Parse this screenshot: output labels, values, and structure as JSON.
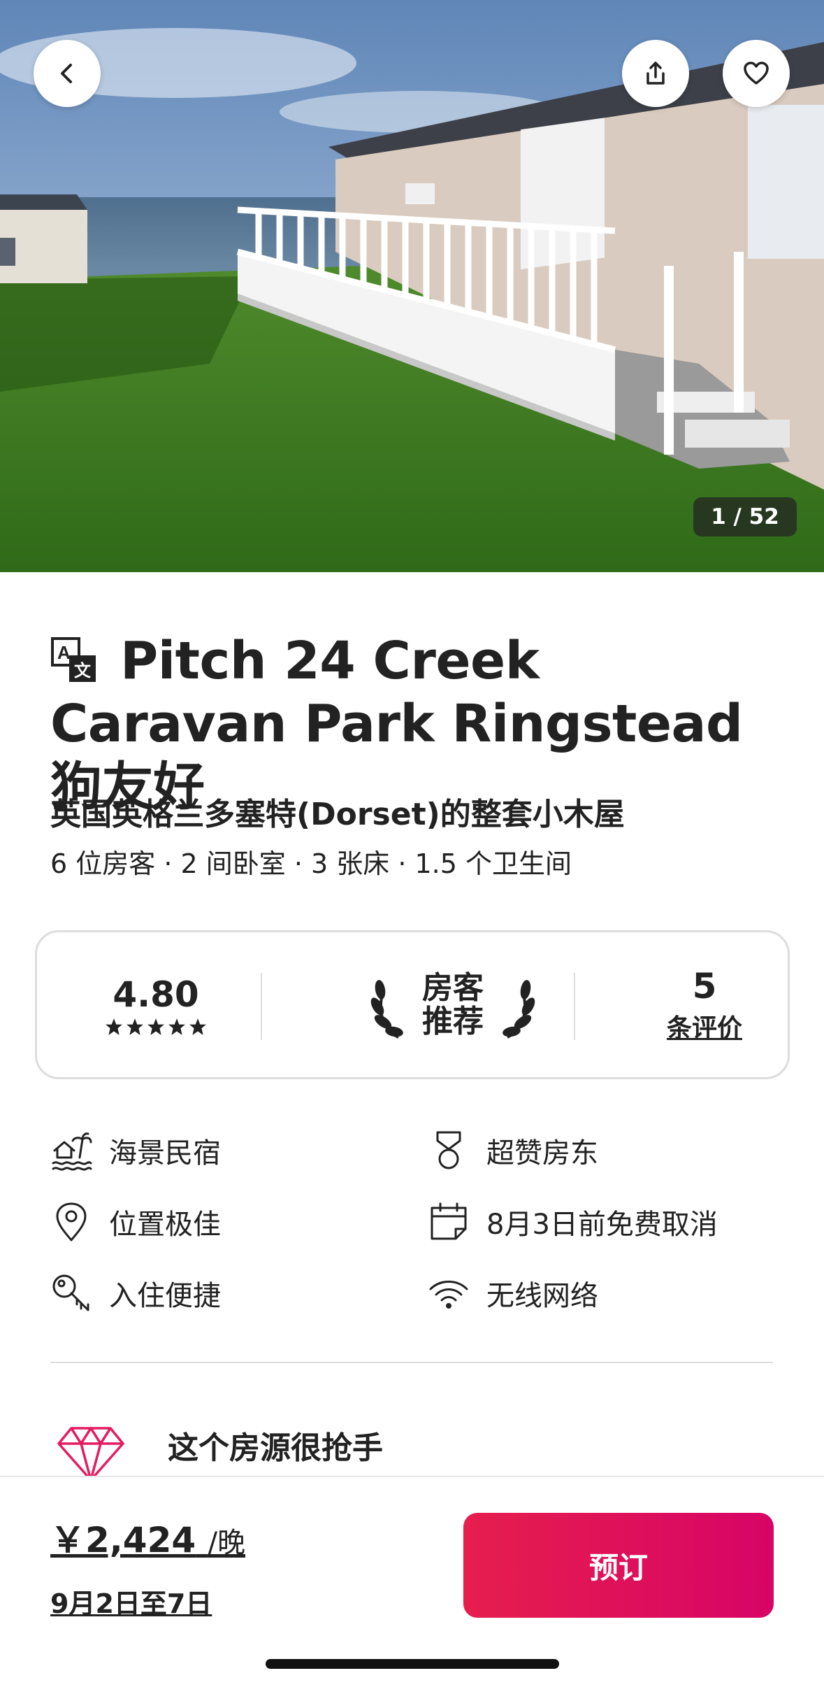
{
  "hero": {
    "photo_counter": "1 / 52"
  },
  "listing": {
    "title": "Pitch 24 Creek Caravan Park Ringstead狗友好",
    "subtitle": "英国英格兰多塞特(Dorset)的整套小木屋",
    "facts": "6 位房客 · 2 间卧室 · 3 张床 · 1.5 个卫生间"
  },
  "rating": {
    "score": "4.80",
    "stars": 5,
    "badge_line1": "房客",
    "badge_line2": "推荐",
    "reviews_count": "5",
    "reviews_label": "条评价"
  },
  "amenities": {
    "sea_view": "海景民宿",
    "superhost": "超赞房东",
    "location": "位置极佳",
    "free_cancel": "8月3日前免费取消",
    "checkin": "入住便捷",
    "wifi": "无线网络"
  },
  "highlight": {
    "text": "这个房源很抢手"
  },
  "booking": {
    "price": "￥2,424",
    "price_unit": "/晚",
    "dates": "9月2日至7日",
    "book_label": "预订"
  },
  "colors": {
    "brand": "#e61e4d",
    "diamond": "#e31c5f"
  }
}
